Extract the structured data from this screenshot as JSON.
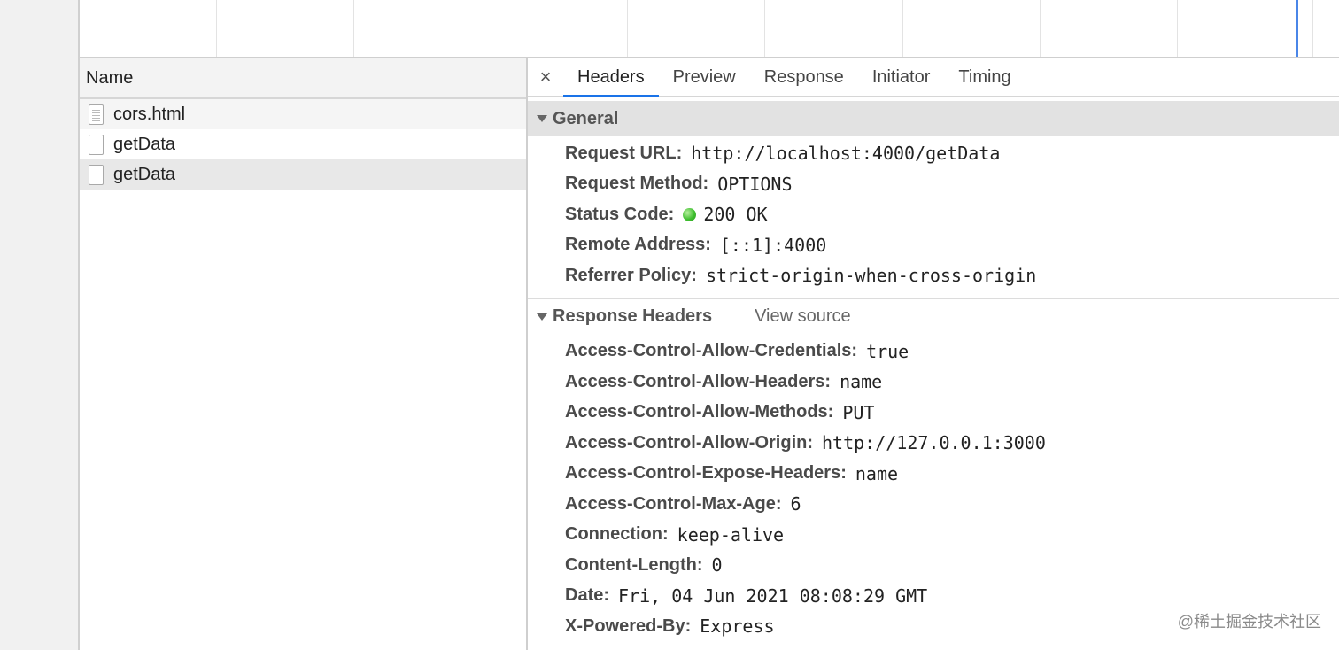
{
  "name_panel": {
    "header": "Name",
    "rows": [
      {
        "label": "cors.html"
      },
      {
        "label": "getData"
      },
      {
        "label": "getData"
      }
    ]
  },
  "detail": {
    "close": "×",
    "tabs": [
      "Headers",
      "Preview",
      "Response",
      "Initiator",
      "Timing"
    ],
    "general": {
      "title": "General",
      "rows": [
        {
          "key": "Request URL:",
          "value": "http://localhost:4000/getData"
        },
        {
          "key": "Request Method:",
          "value": "OPTIONS"
        },
        {
          "key": "Status Code:",
          "value": "200 OK"
        },
        {
          "key": "Remote Address:",
          "value": "[::1]:4000"
        },
        {
          "key": "Referrer Policy:",
          "value": "strict-origin-when-cross-origin"
        }
      ]
    },
    "response_headers": {
      "title": "Response Headers",
      "view_source": "View source",
      "rows": [
        {
          "key": "Access-Control-Allow-Credentials:",
          "value": "true"
        },
        {
          "key": "Access-Control-Allow-Headers:",
          "value": "name"
        },
        {
          "key": "Access-Control-Allow-Methods:",
          "value": "PUT"
        },
        {
          "key": "Access-Control-Allow-Origin:",
          "value": "http://127.0.0.1:3000"
        },
        {
          "key": "Access-Control-Expose-Headers:",
          "value": "name"
        },
        {
          "key": "Access-Control-Max-Age:",
          "value": "6"
        },
        {
          "key": "Connection:",
          "value": "keep-alive"
        },
        {
          "key": "Content-Length:",
          "value": "0"
        },
        {
          "key": "Date:",
          "value": "Fri, 04 Jun 2021 08:08:29 GMT"
        },
        {
          "key": "X-Powered-By:",
          "value": "Express"
        }
      ]
    }
  },
  "watermark": "@稀土掘金技术社区",
  "colors": {
    "accent": "#1a73e8",
    "status_ok": "#3fbf2f"
  }
}
